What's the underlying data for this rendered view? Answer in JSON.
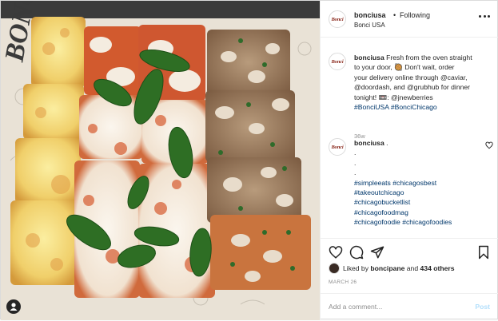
{
  "post": {
    "photo": {
      "alt": "Pizza slices photo",
      "text_on_paper": "BONCI",
      "tag_icon": "person-tag-icon"
    },
    "header": {
      "username": "bonciusa",
      "separator": "•",
      "follow_state": "Following",
      "location": "Bonci USA",
      "avatar_text": "Bonci",
      "more_icon": "more-options-icon"
    },
    "caption": {
      "username": "bonciusa",
      "lines": [
        "Fresh from the oven straight",
        "to your door, 🥘 Don't wait, order",
        "your delivery online through @caviar,",
        "@doordash, and @grubhub for dinner",
        "tonight! 📼: @jnewberries",
        "#BonciUSA #BonciChicago"
      ],
      "time": "36w"
    },
    "comment": {
      "username": "bonciusa",
      "dots": [
        ".",
        ".",
        ".",
        "."
      ],
      "hashtags": [
        "#simpleeats #chicagosbest",
        "#takeoutchicago",
        "#chicagobucketlist",
        "#chicagofoodmag",
        "#chicagofoodie #chicagofoodies"
      ]
    },
    "actions": {
      "like_icon": "heart-icon",
      "comment_icon": "comment-icon",
      "share_icon": "paper-plane-icon",
      "save_icon": "bookmark-icon"
    },
    "likes": {
      "prefix": "Liked by",
      "user": "boncipane",
      "joiner": "and",
      "others": "434 others"
    },
    "date": "MARCH 26",
    "add_comment": {
      "placeholder": "Add a comment...",
      "post_label": "Post"
    },
    "colors": {
      "link": "#00376b",
      "muted": "#8e8e8e",
      "border": "#efefef",
      "post_disabled": "#b2dffc"
    }
  }
}
